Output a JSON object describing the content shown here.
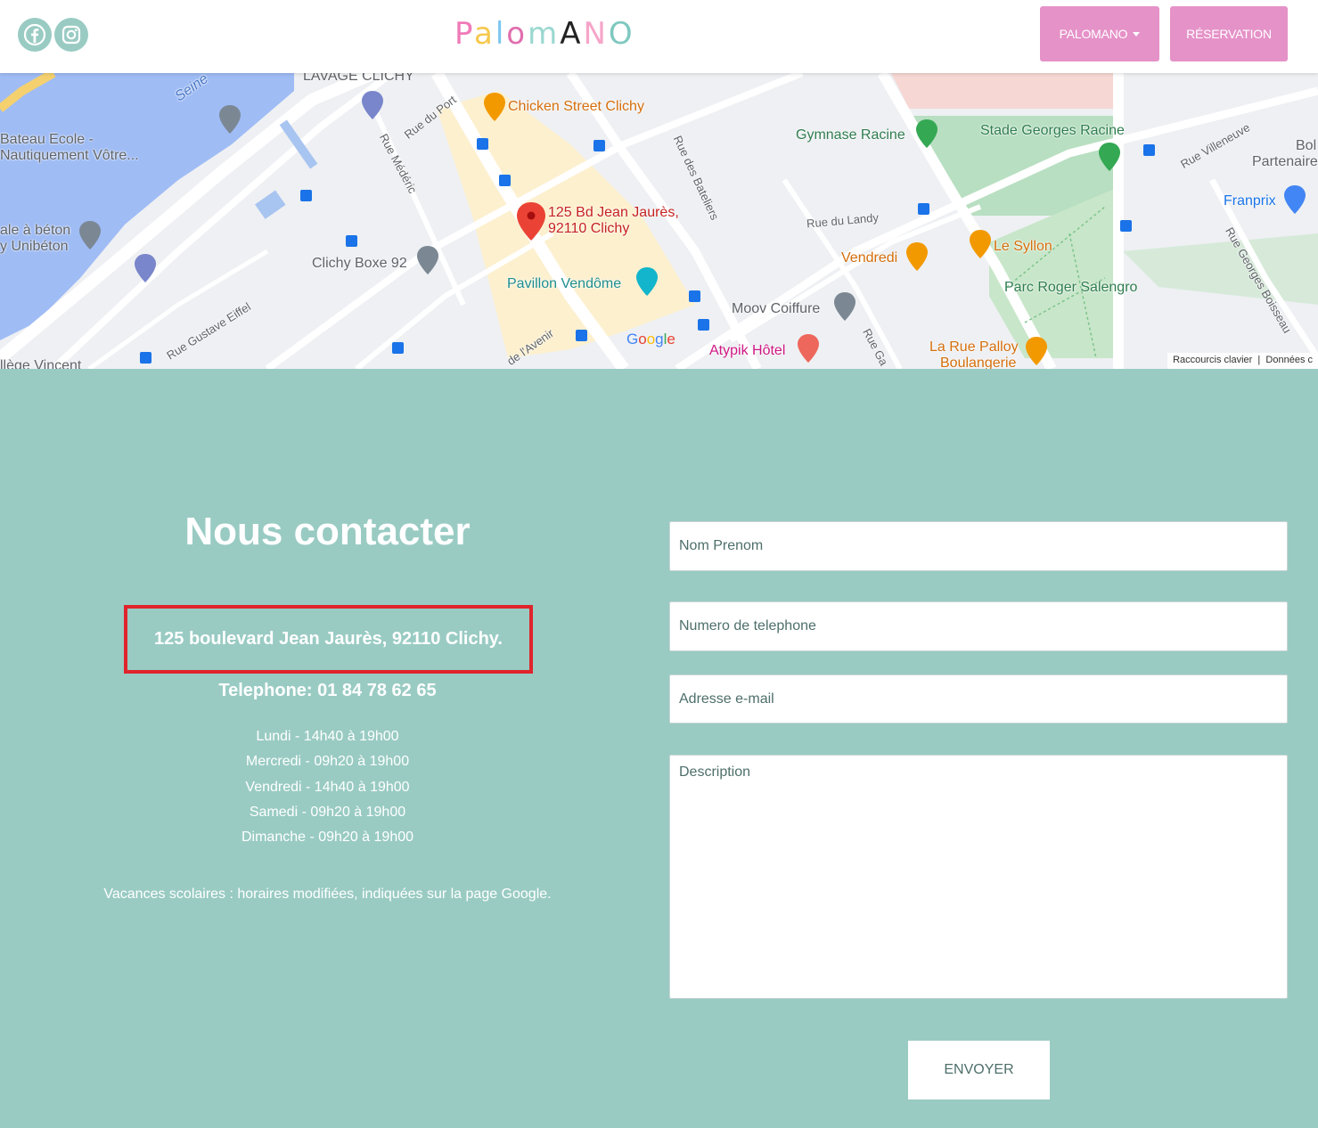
{
  "header": {
    "logo_text": "PalomANO",
    "logo_letters": [
      "P",
      "a",
      "l",
      "o",
      "m",
      "A",
      "N",
      "O"
    ],
    "logo_colors": [
      "#f07ab8",
      "#f6c84d",
      "#7cc6f0",
      "#e06fae",
      "#9ad8d0",
      "#222222",
      "#f6a5c9",
      "#7fc8c0"
    ],
    "social": [
      {
        "name": "facebook-icon"
      },
      {
        "name": "instagram-icon"
      }
    ],
    "nav": {
      "palomano_label": "PALOMANO",
      "reservation_label": "RÉSERVATION"
    },
    "accent_color": "#e592c8"
  },
  "map": {
    "labels": {
      "lavage": "LAVAGE CLICHY",
      "seine": "Seine",
      "bateau_line1": "Bateau Ecole -",
      "bateau_line2": "Nautiquement Vôtre...",
      "beton_line1": "ale à béton",
      "beton_line2": "y Unibéton",
      "chicken": "Chicken Street Clichy",
      "rue_port": "Rue du Port",
      "rue_mederic": "Rue Médéric",
      "rue_bateliers": "Rue des Bateliers",
      "marker_line1": "125 Bd Jean Jaurès,",
      "marker_line2": "92110 Clichy",
      "gymnase": "Gymnase Racine",
      "stade": "Stade Georges Racine",
      "rue_villeneuve": "Rue Villeneuve",
      "bol": "Bol",
      "partenaire": "Partenaire",
      "franprix": "Franprix",
      "rue_landy": "Rue du Landy",
      "vendredi": "Vendredi",
      "le_syllon": "Le Syllon",
      "parc": "Parc Roger Salengro",
      "rue_boisseau": "Rue Georges Boisseau",
      "clichy_boxe": "Clichy Boxe 92",
      "pavillon": "Pavillon Vendôme",
      "moov": "Moov Coiffure",
      "rue_eiffel": "Rue Gustave Eiffel",
      "avenir": "de l'Avenir",
      "atypik": "Atypik Hôtel",
      "rue_ga": "Rue Ga",
      "rue_palloy_line1": "La Rue Palloy",
      "rue_palloy_line2": "Boulangerie",
      "lycee": "llège Vincent",
      "google": "Google"
    },
    "footer": {
      "shortcuts": "Raccourcis clavier",
      "data": "Données c"
    }
  },
  "contact": {
    "title": "Nous contacter",
    "address": "125 boulevard Jean Jaurès, 92110 Clichy.",
    "highlight_color": "#e0242c",
    "phone": "Telephone: 01 84 78 62 65",
    "hours": [
      "Lundi - 14h40 à 19h00",
      "Mercredi - 09h20 à 19h00",
      "Vendredi - 14h40 à 19h00",
      "Samedi - 09h20 à 19h00",
      "Dimanche - 09h20 à 19h00"
    ],
    "holidays_note": "Vacances scolaires : horaires modifiées, indiquées sur la page Google."
  },
  "form": {
    "name_placeholder": "Nom Prenom",
    "phone_placeholder": "Numero de telephone",
    "email_placeholder": "Adresse e-mail",
    "description_placeholder": "Description",
    "submit_label": "ENVOYER"
  },
  "background_color": "#99cbc3"
}
